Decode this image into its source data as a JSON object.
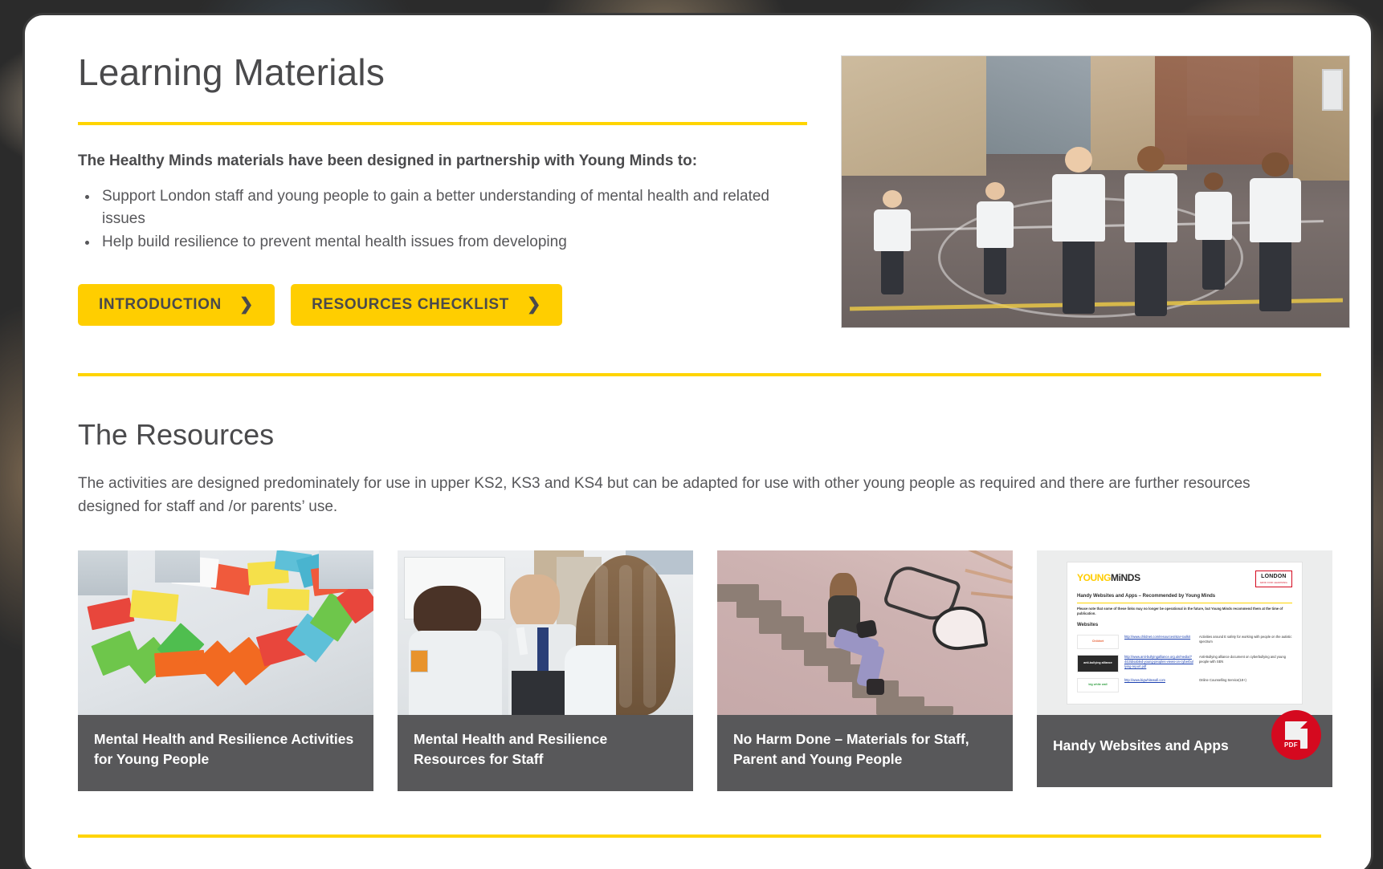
{
  "hero": {
    "title": "Learning Materials",
    "lead": "The Healthy Minds materials have been designed in partnership with Young Minds to:",
    "bullets": [
      "Support London staff and young people to gain a better understanding of mental health and related issues",
      "Help build resilience to prevent mental health issues from developing"
    ],
    "buttons": [
      {
        "label": "INTRODUCTION",
        "chevron": "❯"
      },
      {
        "label": "RESOURCES CHECKLIST",
        "chevron": "❯"
      }
    ],
    "image_alt": "School pupils in white shirts running across a playground"
  },
  "resources": {
    "title": "The Resources",
    "intro": "The activities are designed predominately for use in upper KS2, KS3 and KS4 but can be adapted for use with other young people as required and there are further resources designed for staff and /or parents’ use.",
    "cards": [
      {
        "caption": "Mental Health and Resilience Activities for Young People",
        "thumb_alt": "Coloured sticky notes on a table with pupils writing",
        "badge": null
      },
      {
        "caption": "Mental Health and Resilience Resources for Staff",
        "thumb_alt": "Teacher talking with two pupils in a classroom",
        "badge": null
      },
      {
        "caption": "No Harm Done – Materials for Staff, Parent and Young People",
        "thumb_alt": "Young person sitting on steps beside Tell Someone graffiti",
        "badge": null
      },
      {
        "caption": "Handy Websites and Apps",
        "thumb_alt": "PDF document preview",
        "badge": "PDF"
      }
    ]
  },
  "pdf_preview": {
    "logo_young": "YOUNG",
    "logo_minds": "MiNDS",
    "lgfl_line1": "LONDON",
    "lgfl_line2": "GRID FOR LEARNING",
    "heading": "Handy Websites and Apps – Recommended by Young Minds",
    "note": "Please note that some of these links may no longer be operational in the future, but Young Minds recommend them at the time of publication.",
    "subheading": "Websites",
    "rows": [
      {
        "logo": "Childnet",
        "link": "http://www.childnet.com/resources/star-toolkit",
        "desc": "Activities around E safety for working with people on the autistic spectrum"
      },
      {
        "logo": "anti-bullying alliance",
        "link": "http://www.anti-bullyingalliance.org.uk/media/7443/disabled-young-peoples-views-on-cyberbullying-report.pdf",
        "desc": "Anti-Bullying alliance document on cyberbullying and young people with SEN"
      },
      {
        "logo": "big white wall",
        "link": "http://www.bigwhitewall.com",
        "desc": "Online Counselling Service(18+)"
      }
    ]
  },
  "colors": {
    "accent_yellow": "#FFD400",
    "button_yellow": "#FFCE00",
    "text_dark": "#4A4A4C",
    "body_text": "#57575A",
    "caption_bg": "#58585A",
    "pdf_red": "#D5091F"
  }
}
